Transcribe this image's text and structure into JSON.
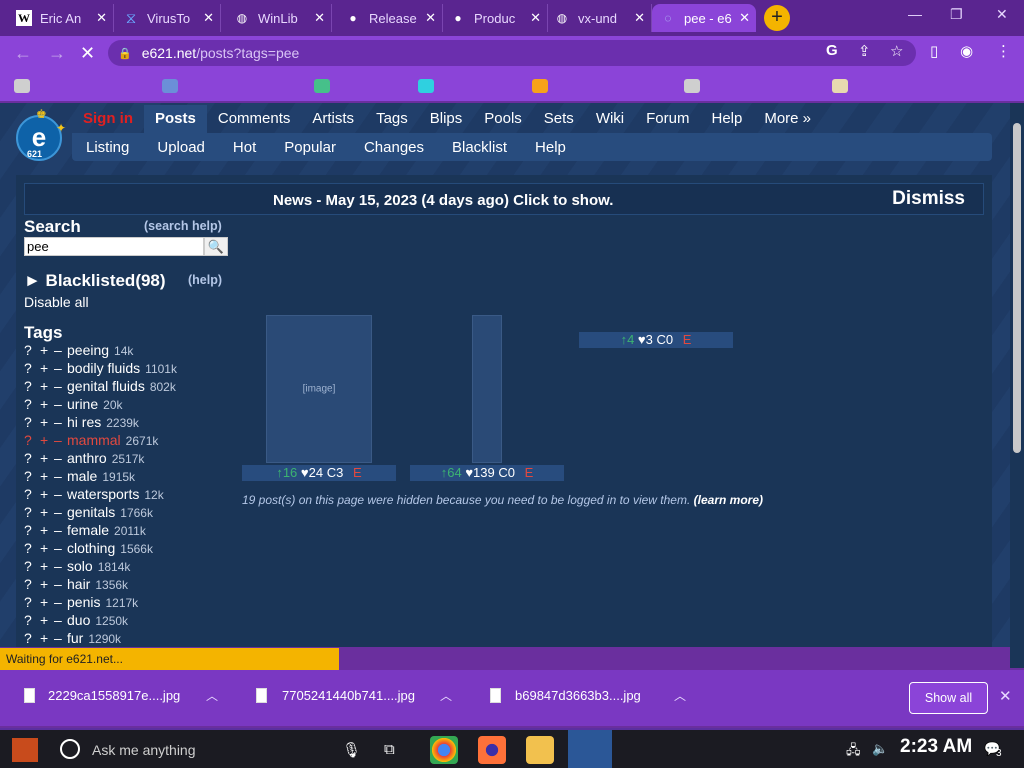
{
  "browser": {
    "tabs": [
      {
        "title": "Eric An",
        "active": false
      },
      {
        "title": "VirusTo",
        "active": false
      },
      {
        "title": "WinLib",
        "active": false
      },
      {
        "title": "Release",
        "active": false
      },
      {
        "title": "Produc",
        "active": false
      },
      {
        "title": "vx-und",
        "active": false
      },
      {
        "title": "pee - e6",
        "active": true
      }
    ],
    "new_tab": "+",
    "url_host": "e621.net",
    "url_path": "/posts?tags=pee",
    "status": "Waiting for e621.net..."
  },
  "site": {
    "logo": "e",
    "logo_sub": "621",
    "nav": {
      "signin": "Sign in",
      "posts": "Posts",
      "comments": "Comments",
      "artists": "Artists",
      "tags": "Tags",
      "blips": "Blips",
      "pools": "Pools",
      "sets": "Sets",
      "wiki": "Wiki",
      "forum": "Forum",
      "help": "Help",
      "more": "More »"
    },
    "subnav": [
      "Listing",
      "Upload",
      "Hot",
      "Popular",
      "Changes",
      "Blacklist",
      "Help"
    ],
    "news": {
      "text": "News - May 15, 2023 (4 days ago) Click to show.",
      "dismiss": "Dismiss"
    }
  },
  "sidebar": {
    "search_title": "Search",
    "search_help": "(search help)",
    "search_value": "pee",
    "blacklisted": "► Blacklisted(98)",
    "blacklist_help": "(help)",
    "disable_all": "Disable all",
    "tags_title": "Tags",
    "tags": [
      {
        "name": "peeing",
        "count": "14k"
      },
      {
        "name": "bodily fluids",
        "count": "1101k"
      },
      {
        "name": "genital fluids",
        "count": "802k"
      },
      {
        "name": "urine",
        "count": "20k"
      },
      {
        "name": "hi res",
        "count": "2239k"
      },
      {
        "name": "mammal",
        "count": "2671k",
        "special": true
      },
      {
        "name": "anthro",
        "count": "2517k"
      },
      {
        "name": "male",
        "count": "1915k"
      },
      {
        "name": "watersports",
        "count": "12k"
      },
      {
        "name": "genitals",
        "count": "1766k"
      },
      {
        "name": "female",
        "count": "2011k"
      },
      {
        "name": "clothing",
        "count": "1566k"
      },
      {
        "name": "solo",
        "count": "1814k"
      },
      {
        "name": "hair",
        "count": "1356k"
      },
      {
        "name": "penis",
        "count": "1217k"
      },
      {
        "name": "duo",
        "count": "1250k"
      },
      {
        "name": "fur",
        "count": "1290k"
      }
    ]
  },
  "posts": [
    {
      "up": "↑16",
      "favs": "♥24",
      "comments": "C3",
      "rating": "E"
    },
    {
      "up": "↑64",
      "favs": "♥139",
      "comments": "C0",
      "rating": "E"
    },
    {
      "up": "↑4",
      "favs": "♥3",
      "comments": "C0",
      "rating": "E"
    }
  ],
  "hidden_note": "19 post(s) on this page were hidden because you need to be logged in to view them.",
  "learn_more": "(learn more)",
  "downloads": {
    "files": [
      "2229ca1558917e....jpg",
      "7705241440b741....jpg",
      "b69847d3663b3....jpg"
    ],
    "show_all": "Show all"
  },
  "taskbar": {
    "search_placeholder": "Ask me anything",
    "clock": "2:23 AM",
    "notifications": "3"
  }
}
